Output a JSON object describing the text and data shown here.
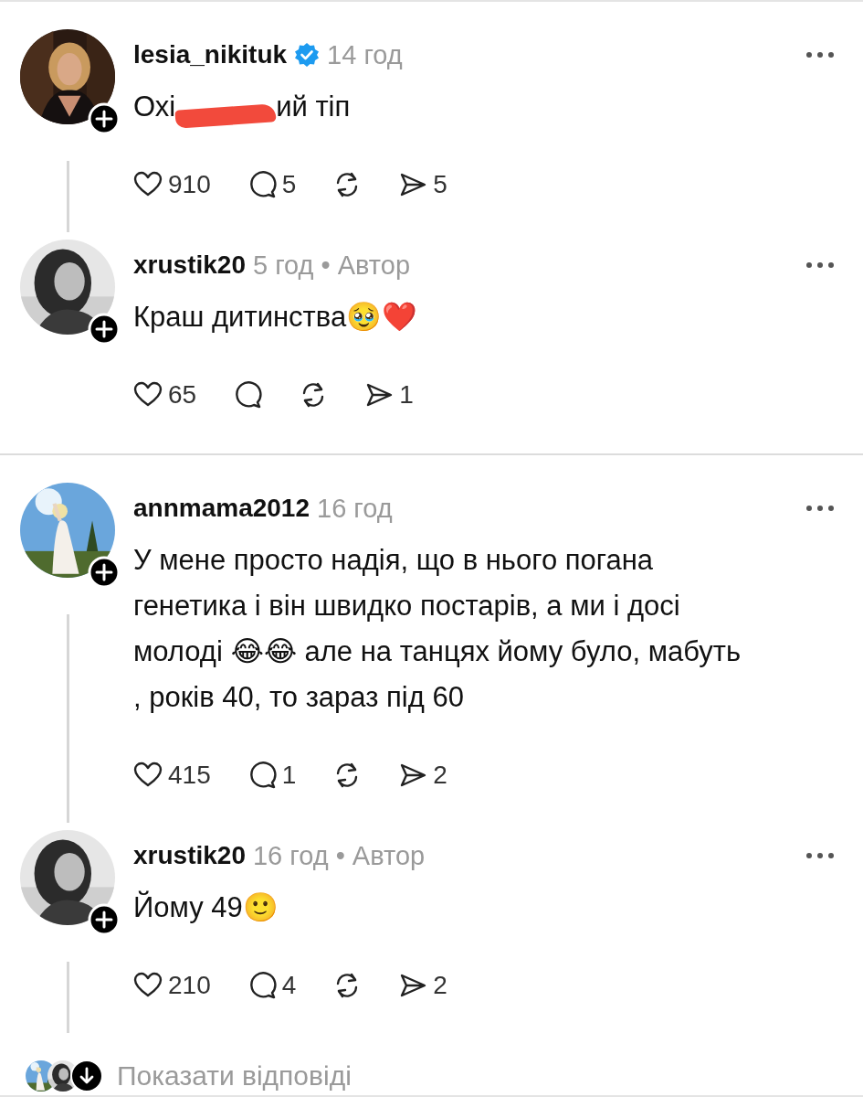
{
  "threads": [
    {
      "posts": [
        {
          "username": "lesia_nikituk",
          "verified": true,
          "time": "14 год",
          "text_parts": [
            {
              "kind": "text",
              "text": "Охі"
            },
            {
              "kind": "redaction"
            },
            {
              "kind": "text",
              "text": "ий тіп"
            }
          ],
          "stats": [
            {
              "kind": "like",
              "count": "910"
            },
            {
              "kind": "reply",
              "count": "5"
            },
            {
              "kind": "repost"
            },
            {
              "kind": "share",
              "count": "5"
            }
          ],
          "thread_line": true
        },
        {
          "username": "xrustik20",
          "verified": false,
          "time": "5 год",
          "author_label": "• Автор",
          "text_parts": [
            {
              "kind": "text",
              "text": "Краш дитинства🥹❤️"
            }
          ],
          "stats": [
            {
              "kind": "like",
              "count": "65"
            },
            {
              "kind": "reply"
            },
            {
              "kind": "repost"
            },
            {
              "kind": "share",
              "count": "1"
            }
          ],
          "thread_line": false
        }
      ]
    },
    {
      "posts": [
        {
          "username": "annmama2012",
          "verified": false,
          "time": "16 год",
          "text_parts": [
            {
              "kind": "text",
              "text": "У мене просто надія, що в нього погана генетика і він швидко постарів, а ми і досі молоді 😂😂 але на танцях йому було, мабуть , років 40, то зараз під 60"
            }
          ],
          "stats": [
            {
              "kind": "like",
              "count": "415"
            },
            {
              "kind": "reply",
              "count": "1"
            },
            {
              "kind": "repost"
            },
            {
              "kind": "share",
              "count": "2"
            }
          ],
          "thread_line": true
        },
        {
          "username": "xrustik20",
          "verified": false,
          "time": "16 год",
          "author_label": "• Автор",
          "text_parts": [
            {
              "kind": "text",
              "text": "Йому 49🙂"
            }
          ],
          "stats": [
            {
              "kind": "like",
              "count": "210"
            },
            {
              "kind": "reply",
              "count": "4"
            },
            {
              "kind": "repost"
            },
            {
              "kind": "share",
              "count": "2"
            }
          ],
          "thread_line": true
        }
      ],
      "show_replies": {
        "label": "Показати відповіді"
      }
    }
  ]
}
